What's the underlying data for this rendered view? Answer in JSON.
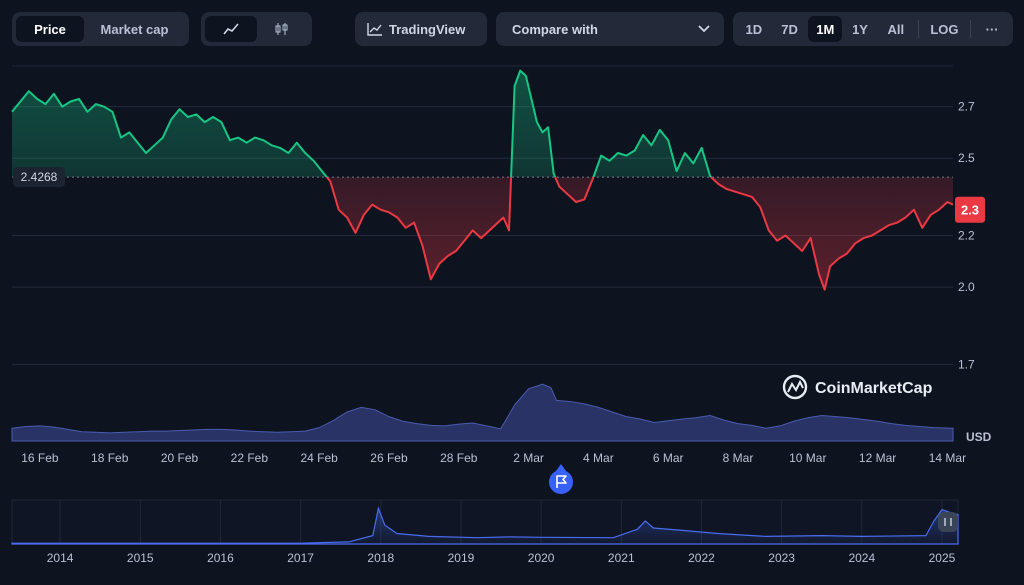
{
  "toolbar": {
    "price_label": "Price",
    "market_cap_label": "Market cap",
    "tradingview_label": "TradingView",
    "compare_label": "Compare with",
    "ranges": [
      "1D",
      "7D",
      "1M",
      "1Y",
      "All"
    ],
    "selected_range": "1M",
    "log_label": "LOG",
    "more_label": "···"
  },
  "watermark": "CoinMarketCap",
  "colors": {
    "up": "#16c784",
    "down": "#ea3943",
    "volume": "#3d4a8a",
    "background": "#0e1320"
  },
  "chart_data": {
    "type": "line",
    "currency_label": "USD",
    "reference_value": 2.4268,
    "reference_label": "2.4268",
    "current_value": 2.3,
    "current_label": "2.3",
    "ylim": [
      1.62,
      2.85
    ],
    "y_ticks": [
      {
        "value": 2.7,
        "label": "2.7"
      },
      {
        "value": 2.5,
        "label": "2.5"
      },
      {
        "value": 2.2,
        "label": "2.2"
      },
      {
        "value": 2.0,
        "label": "2.0"
      },
      {
        "value": 1.7,
        "label": "1.7"
      }
    ],
    "x_ticks": [
      "16 Feb",
      "18 Feb",
      "20 Feb",
      "22 Feb",
      "24 Feb",
      "26 Feb",
      "28 Feb",
      "2 Mar",
      "4 Mar",
      "6 Mar",
      "8 Mar",
      "10 Mar",
      "12 Mar",
      "14 Mar"
    ],
    "price": [
      [
        14.0,
        2.68
      ],
      [
        14.3,
        2.72
      ],
      [
        14.6,
        2.76
      ],
      [
        14.9,
        2.73
      ],
      [
        15.2,
        2.71
      ],
      [
        15.5,
        2.75
      ],
      [
        15.8,
        2.7
      ],
      [
        16.1,
        2.72
      ],
      [
        16.4,
        2.73
      ],
      [
        16.7,
        2.68
      ],
      [
        17.0,
        2.71
      ],
      [
        17.3,
        2.7
      ],
      [
        17.6,
        2.68
      ],
      [
        17.9,
        2.58
      ],
      [
        18.2,
        2.6
      ],
      [
        18.5,
        2.56
      ],
      [
        18.8,
        2.52
      ],
      [
        19.1,
        2.55
      ],
      [
        19.4,
        2.58
      ],
      [
        19.7,
        2.65
      ],
      [
        20.0,
        2.69
      ],
      [
        20.3,
        2.66
      ],
      [
        20.6,
        2.67
      ],
      [
        20.9,
        2.64
      ],
      [
        21.2,
        2.66
      ],
      [
        21.5,
        2.64
      ],
      [
        21.8,
        2.57
      ],
      [
        22.1,
        2.58
      ],
      [
        22.4,
        2.56
      ],
      [
        22.7,
        2.58
      ],
      [
        23.0,
        2.57
      ],
      [
        23.3,
        2.55
      ],
      [
        23.6,
        2.54
      ],
      [
        23.9,
        2.52
      ],
      [
        24.2,
        2.56
      ],
      [
        24.5,
        2.52
      ],
      [
        24.8,
        2.49
      ],
      [
        25.1,
        2.45
      ],
      [
        25.4,
        2.41
      ],
      [
        25.7,
        2.3
      ],
      [
        26.0,
        2.27
      ],
      [
        26.3,
        2.21
      ],
      [
        26.6,
        2.28
      ],
      [
        26.9,
        2.32
      ],
      [
        27.2,
        2.3
      ],
      [
        27.5,
        2.29
      ],
      [
        27.8,
        2.27
      ],
      [
        28.1,
        2.23
      ],
      [
        28.4,
        2.25
      ],
      [
        28.7,
        2.16
      ],
      [
        29.0,
        2.03
      ],
      [
        29.3,
        2.09
      ],
      [
        29.6,
        2.12
      ],
      [
        29.9,
        2.14
      ],
      [
        30.2,
        2.18
      ],
      [
        30.5,
        2.22
      ],
      [
        30.8,
        2.19
      ],
      [
        31.1,
        2.22
      ],
      [
        31.4,
        2.25
      ],
      [
        31.6,
        2.27
      ],
      [
        31.8,
        2.22
      ],
      [
        32.0,
        2.78
      ],
      [
        32.2,
        2.84
      ],
      [
        32.4,
        2.82
      ],
      [
        32.6,
        2.73
      ],
      [
        32.8,
        2.64
      ],
      [
        33.0,
        2.6
      ],
      [
        33.2,
        2.62
      ],
      [
        33.4,
        2.44
      ],
      [
        33.6,
        2.39
      ],
      [
        33.9,
        2.36
      ],
      [
        34.2,
        2.33
      ],
      [
        34.5,
        2.34
      ],
      [
        34.8,
        2.42
      ],
      [
        35.1,
        2.51
      ],
      [
        35.4,
        2.49
      ],
      [
        35.7,
        2.52
      ],
      [
        36.0,
        2.51
      ],
      [
        36.3,
        2.53
      ],
      [
        36.6,
        2.59
      ],
      [
        36.9,
        2.55
      ],
      [
        37.2,
        2.61
      ],
      [
        37.5,
        2.57
      ],
      [
        37.8,
        2.45
      ],
      [
        38.1,
        2.52
      ],
      [
        38.4,
        2.48
      ],
      [
        38.7,
        2.54
      ],
      [
        39.0,
        2.43
      ],
      [
        39.3,
        2.4
      ],
      [
        39.6,
        2.38
      ],
      [
        39.9,
        2.37
      ],
      [
        40.2,
        2.36
      ],
      [
        40.5,
        2.35
      ],
      [
        40.8,
        2.31
      ],
      [
        41.1,
        2.22
      ],
      [
        41.4,
        2.18
      ],
      [
        41.7,
        2.2
      ],
      [
        42.0,
        2.17
      ],
      [
        42.3,
        2.14
      ],
      [
        42.6,
        2.19
      ],
      [
        42.9,
        2.05
      ],
      [
        43.1,
        1.99
      ],
      [
        43.3,
        2.08
      ],
      [
        43.6,
        2.11
      ],
      [
        43.9,
        2.13
      ],
      [
        44.2,
        2.17
      ],
      [
        44.5,
        2.19
      ],
      [
        44.8,
        2.2
      ],
      [
        45.1,
        2.22
      ],
      [
        45.4,
        2.24
      ],
      [
        45.7,
        2.25
      ],
      [
        46.0,
        2.27
      ],
      [
        46.3,
        2.3
      ],
      [
        46.6,
        2.23
      ],
      [
        46.9,
        2.28
      ],
      [
        47.2,
        2.3
      ],
      [
        47.5,
        2.33
      ],
      [
        47.7,
        2.32
      ]
    ],
    "volume": [
      [
        14.0,
        0.22
      ],
      [
        14.5,
        0.25
      ],
      [
        15.0,
        0.26
      ],
      [
        15.5,
        0.24
      ],
      [
        16.0,
        0.2
      ],
      [
        16.5,
        0.16
      ],
      [
        17.0,
        0.15
      ],
      [
        17.5,
        0.14
      ],
      [
        18.0,
        0.15
      ],
      [
        18.5,
        0.16
      ],
      [
        19.0,
        0.17
      ],
      [
        19.5,
        0.17
      ],
      [
        20.0,
        0.18
      ],
      [
        20.5,
        0.19
      ],
      [
        21.0,
        0.2
      ],
      [
        21.5,
        0.2
      ],
      [
        22.0,
        0.19
      ],
      [
        22.5,
        0.17
      ],
      [
        23.0,
        0.16
      ],
      [
        23.5,
        0.15
      ],
      [
        24.0,
        0.16
      ],
      [
        24.5,
        0.17
      ],
      [
        25.0,
        0.23
      ],
      [
        25.5,
        0.35
      ],
      [
        26.0,
        0.5
      ],
      [
        26.5,
        0.58
      ],
      [
        27.0,
        0.54
      ],
      [
        27.5,
        0.42
      ],
      [
        28.0,
        0.34
      ],
      [
        28.5,
        0.3
      ],
      [
        29.0,
        0.27
      ],
      [
        29.5,
        0.26
      ],
      [
        30.0,
        0.29
      ],
      [
        30.5,
        0.31
      ],
      [
        31.0,
        0.26
      ],
      [
        31.5,
        0.21
      ],
      [
        32.0,
        0.62
      ],
      [
        32.5,
        0.9
      ],
      [
        33.0,
        0.98
      ],
      [
        33.3,
        0.92
      ],
      [
        33.5,
        0.7
      ],
      [
        34.0,
        0.68
      ],
      [
        34.5,
        0.64
      ],
      [
        35.0,
        0.58
      ],
      [
        35.5,
        0.5
      ],
      [
        36.0,
        0.42
      ],
      [
        36.5,
        0.38
      ],
      [
        37.0,
        0.32
      ],
      [
        37.5,
        0.35
      ],
      [
        38.0,
        0.38
      ],
      [
        38.5,
        0.4
      ],
      [
        39.0,
        0.44
      ],
      [
        39.5,
        0.36
      ],
      [
        40.0,
        0.3
      ],
      [
        40.5,
        0.27
      ],
      [
        41.0,
        0.22
      ],
      [
        41.5,
        0.26
      ],
      [
        42.0,
        0.34
      ],
      [
        42.5,
        0.4
      ],
      [
        43.0,
        0.44
      ],
      [
        43.5,
        0.42
      ],
      [
        44.0,
        0.4
      ],
      [
        44.5,
        0.37
      ],
      [
        45.0,
        0.34
      ],
      [
        45.5,
        0.3
      ],
      [
        46.0,
        0.27
      ],
      [
        46.5,
        0.25
      ],
      [
        47.0,
        0.23
      ],
      [
        47.7,
        0.22
      ]
    ],
    "overview": {
      "years": [
        "2014",
        "2015",
        "2016",
        "2017",
        "2018",
        "2019",
        "2020",
        "2021",
        "2022",
        "2023",
        "2024",
        "2025"
      ],
      "series": [
        [
          2013.4,
          0.02
        ],
        [
          2017.0,
          0.02
        ],
        [
          2017.6,
          0.05
        ],
        [
          2017.9,
          0.2
        ],
        [
          2017.97,
          0.85
        ],
        [
          2018.05,
          0.45
        ],
        [
          2018.2,
          0.25
        ],
        [
          2018.6,
          0.18
        ],
        [
          2019.2,
          0.15
        ],
        [
          2019.6,
          0.17
        ],
        [
          2020.0,
          0.16
        ],
        [
          2020.9,
          0.15
        ],
        [
          2021.2,
          0.35
        ],
        [
          2021.3,
          0.55
        ],
        [
          2021.4,
          0.38
        ],
        [
          2021.8,
          0.32
        ],
        [
          2022.2,
          0.25
        ],
        [
          2022.8,
          0.18
        ],
        [
          2023.5,
          0.2
        ],
        [
          2024.0,
          0.18
        ],
        [
          2024.8,
          0.2
        ],
        [
          2024.9,
          0.55
        ],
        [
          2025.0,
          0.82
        ],
        [
          2025.1,
          0.75
        ],
        [
          2025.2,
          0.7
        ]
      ]
    }
  }
}
